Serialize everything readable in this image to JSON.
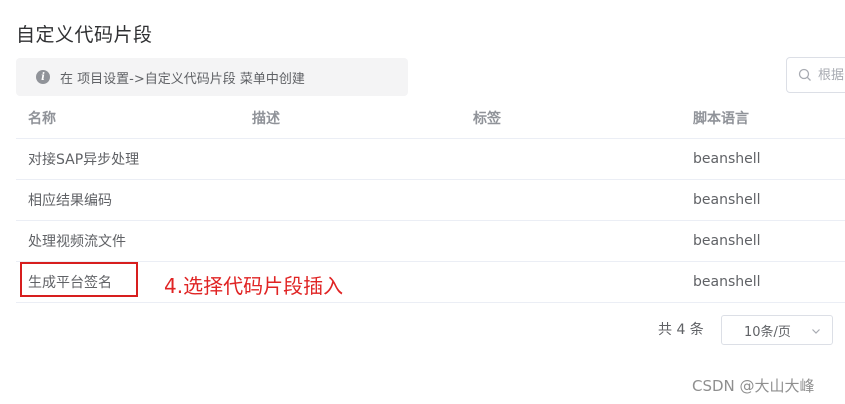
{
  "page": {
    "title": "自定义代码片段"
  },
  "tip": {
    "text": "在 项目设置->自定义代码片段 菜单中创建"
  },
  "search": {
    "placeholder": "根据"
  },
  "table": {
    "columns": [
      "名称",
      "描述",
      "标签",
      "脚本语言"
    ],
    "rows": [
      {
        "name": "对接SAP异步处理",
        "description": "",
        "tags": "",
        "language": "beanshell"
      },
      {
        "name": "相应结果编码",
        "description": "",
        "tags": "",
        "language": "beanshell"
      },
      {
        "name": "处理视频流文件",
        "description": "",
        "tags": "",
        "language": "beanshell"
      },
      {
        "name": "生成平台签名",
        "description": "",
        "tags": "",
        "language": "beanshell"
      }
    ]
  },
  "annotation": {
    "text": "4.选择代码片段插入",
    "color": "#e02424"
  },
  "pagination": {
    "total_text": "共 4 条",
    "page_size": "10条/页"
  },
  "watermark": {
    "text": "CSDN @大山大峰"
  }
}
